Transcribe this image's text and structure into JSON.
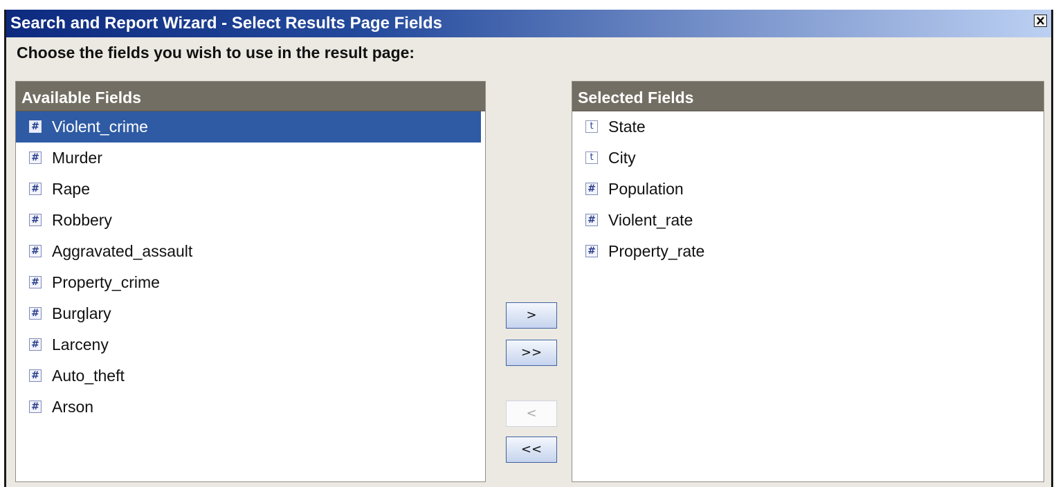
{
  "window": {
    "title": "Search and Report Wizard - Select Results Page Fields",
    "close_icon": "close-x-icon"
  },
  "instruction": "Choose the fields you wish to use in the result page:",
  "available": {
    "header": "Available Fields",
    "items": [
      {
        "label": "Violent_crime",
        "type": "#",
        "selected": true
      },
      {
        "label": "Murder",
        "type": "#"
      },
      {
        "label": "Rape",
        "type": "#"
      },
      {
        "label": "Robbery",
        "type": "#"
      },
      {
        "label": "Aggravated_assault",
        "type": "#"
      },
      {
        "label": "Property_crime",
        "type": "#"
      },
      {
        "label": "Burglary",
        "type": "#"
      },
      {
        "label": "Larceny",
        "type": "#"
      },
      {
        "label": "Auto_theft",
        "type": "#"
      },
      {
        "label": "Arson",
        "type": "#"
      }
    ]
  },
  "selected": {
    "header": "Selected Fields",
    "items": [
      {
        "label": "State",
        "type": "t"
      },
      {
        "label": "City",
        "type": "t"
      },
      {
        "label": "Population",
        "type": "#"
      },
      {
        "label": "Violent_rate",
        "type": "#"
      },
      {
        "label": "Property_rate",
        "type": "#"
      }
    ]
  },
  "buttons": {
    "add": ">",
    "add_all": ">>",
    "remove": "<",
    "remove_all": "<<",
    "remove_enabled": false
  },
  "colors": {
    "selection": "#2f5ba4",
    "list_header": "#736e63",
    "dialog_bg": "#ece9e2"
  }
}
